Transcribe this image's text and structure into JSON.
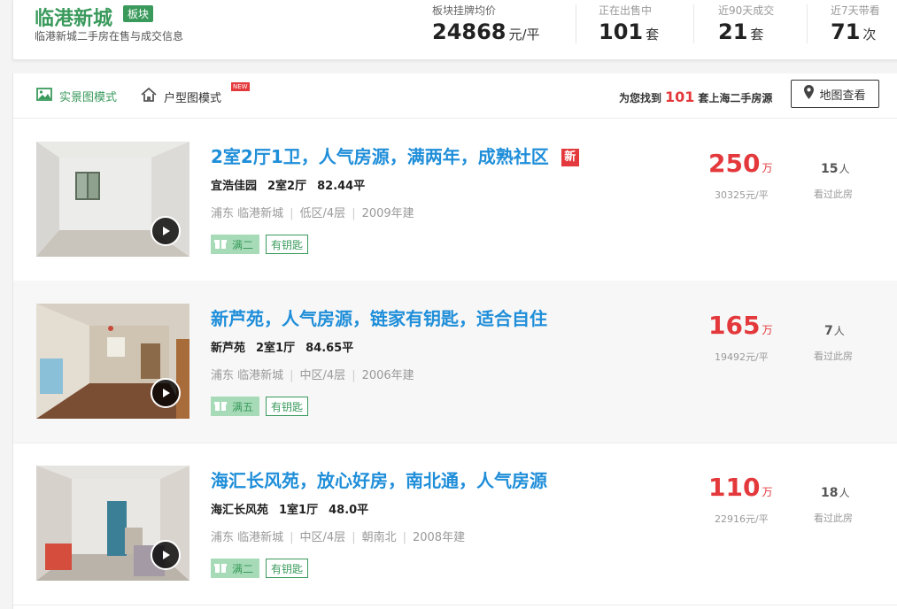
{
  "header": {
    "district": "临港新城",
    "badge": "板块",
    "subtitle": "临港新城二手房在售与成交信息",
    "stats": [
      {
        "label": "板块挂牌均价",
        "value": "24868",
        "unit": "元/平"
      },
      {
        "label": "正在出售中",
        "value": "101",
        "unit": "套"
      },
      {
        "label": "近90天成交",
        "value": "21",
        "unit": "套"
      },
      {
        "label": "近7天带看",
        "value": "71",
        "unit": "次"
      }
    ]
  },
  "toolbar": {
    "mode_photo": "实景图模式",
    "mode_floorplan": "户型图模式",
    "new_tag": "NEW",
    "found_prefix": "为您找到",
    "found_count": "101",
    "found_suffix": "套上海二手房源",
    "map_button": "地图查看"
  },
  "listings": [
    {
      "title": "2室2厅1卫，人气房源，满两年，成熟社区",
      "new_badge": "新",
      "community": "宜浩佳园",
      "layout": "2室2厅",
      "area": "82.44平",
      "location": [
        "浦东 临港新城",
        "低区/4层",
        "2009年建"
      ],
      "tag_years": "满二",
      "tag_key": "有钥匙",
      "price": "250",
      "price_unit": "万",
      "unit_price": "30325元/平",
      "viewed": "15",
      "viewed_unit": "人",
      "viewed_label": "看过此房"
    },
    {
      "title": "新芦苑，人气房源，链家有钥匙，适合自住",
      "community": "新芦苑",
      "layout": "2室1厅",
      "area": "84.65平",
      "location": [
        "浦东 临港新城",
        "中区/4层",
        "2006年建"
      ],
      "tag_years": "满五",
      "tag_key": "有钥匙",
      "price": "165",
      "price_unit": "万",
      "unit_price": "19492元/平",
      "viewed": "7",
      "viewed_unit": "人",
      "viewed_label": "看过此房"
    },
    {
      "title": "海汇长风苑，放心好房，南北通，人气房源",
      "community": "海汇长风苑",
      "layout": "1室1厅",
      "area": "48.0平",
      "location": [
        "浦东 临港新城",
        "中区/4层",
        "朝南北",
        "2008年建"
      ],
      "tag_years": "满二",
      "tag_key": "有钥匙",
      "price": "110",
      "price_unit": "万",
      "unit_price": "22916元/平",
      "viewed": "18",
      "viewed_unit": "人",
      "viewed_label": "看过此房"
    }
  ]
}
